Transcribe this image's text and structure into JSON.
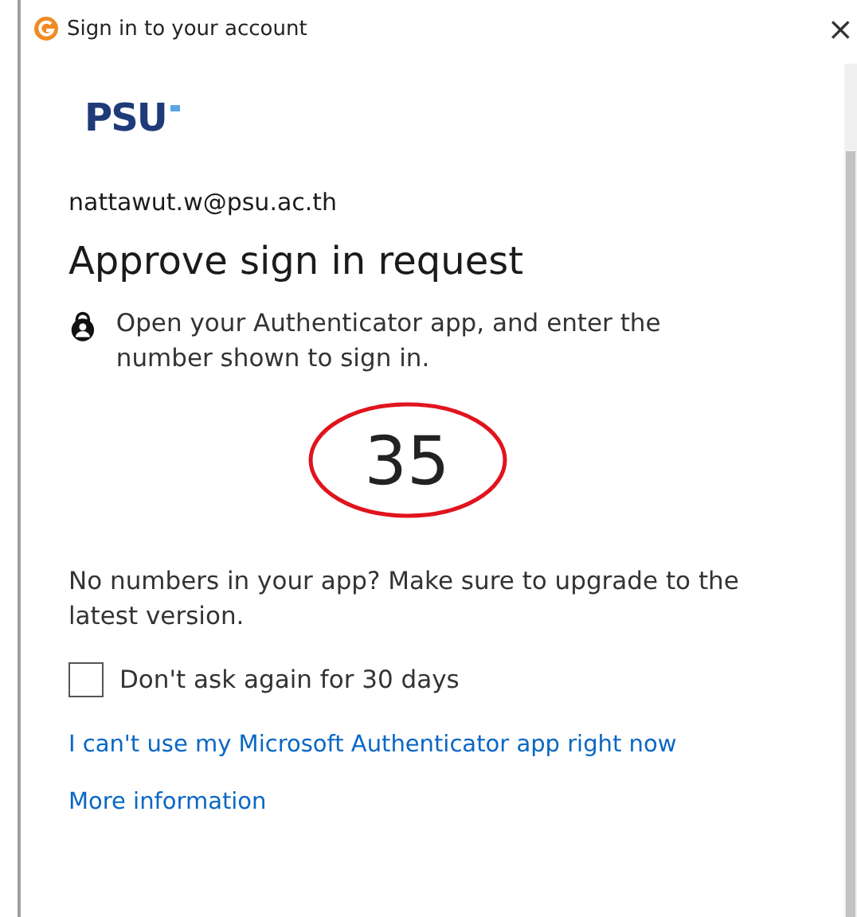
{
  "window": {
    "title": "Sign in to your account",
    "close": "×"
  },
  "logo": "PSU",
  "account": "nattawut.w@psu.ac.th",
  "heading": "Approve sign in request",
  "instruction": "Open your Authenticator app, and enter the number shown to sign in.",
  "number": "35",
  "number_circled": true,
  "note": "No numbers in your app? Make sure to upgrade to the latest version.",
  "remember": {
    "label": "Don't ask again for 30 days",
    "checked": false
  },
  "links": [
    "I can't use my Microsoft Authenticator app right now",
    "More information"
  ]
}
